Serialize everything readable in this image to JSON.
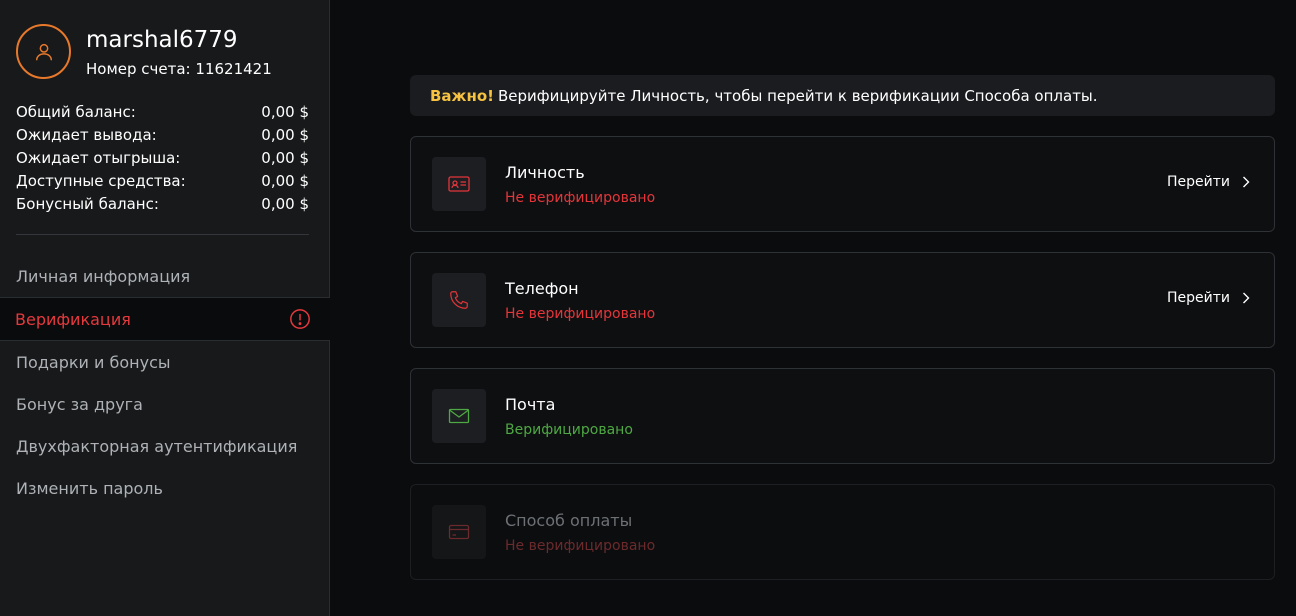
{
  "profile": {
    "username": "marshal6779",
    "account_label": "Номер счета:",
    "account_number": "11621421",
    "avatar_icon": "user-icon",
    "accent": "#e8792b"
  },
  "balances": [
    {
      "label": "Общий баланс:",
      "value": "0,00 $"
    },
    {
      "label": "Ожидает вывода:",
      "value": "0,00 $"
    },
    {
      "label": "Ожидает отыгрыша:",
      "value": "0,00 $"
    },
    {
      "label": "Доступные средства:",
      "value": "0,00 $"
    },
    {
      "label": "Бонусный баланс:",
      "value": "0,00 $"
    }
  ],
  "menu": [
    {
      "label": "Личная информация"
    },
    {
      "label": "Верификация",
      "active": true,
      "icon": "alert-circle-icon"
    },
    {
      "label": "Подарки и бонусы"
    },
    {
      "label": "Бонус за друга"
    },
    {
      "label": "Двухфакторная аутентификация"
    },
    {
      "label": "Изменить пароль"
    }
  ],
  "notice": {
    "strong": "Важно!",
    "text": "Верифицируйте Личность, чтобы перейти к верификации Способа оплаты."
  },
  "cards": [
    {
      "title": "Личность",
      "status": "Не верифицировано",
      "action": "Перейти",
      "icon": "id-card-icon"
    },
    {
      "title": "Телефон",
      "status": "Не верифицировано",
      "action": "Перейти",
      "icon": "phone-icon"
    },
    {
      "title": "Почта",
      "status": "Верифицировано",
      "icon": "mail-icon"
    },
    {
      "title": "Способ оплаты",
      "status": "Не верифицировано",
      "icon": "credit-card-icon"
    }
  ],
  "colors": {
    "danger": "#e3353a",
    "success": "#4ea843",
    "warning": "#f5c242"
  }
}
